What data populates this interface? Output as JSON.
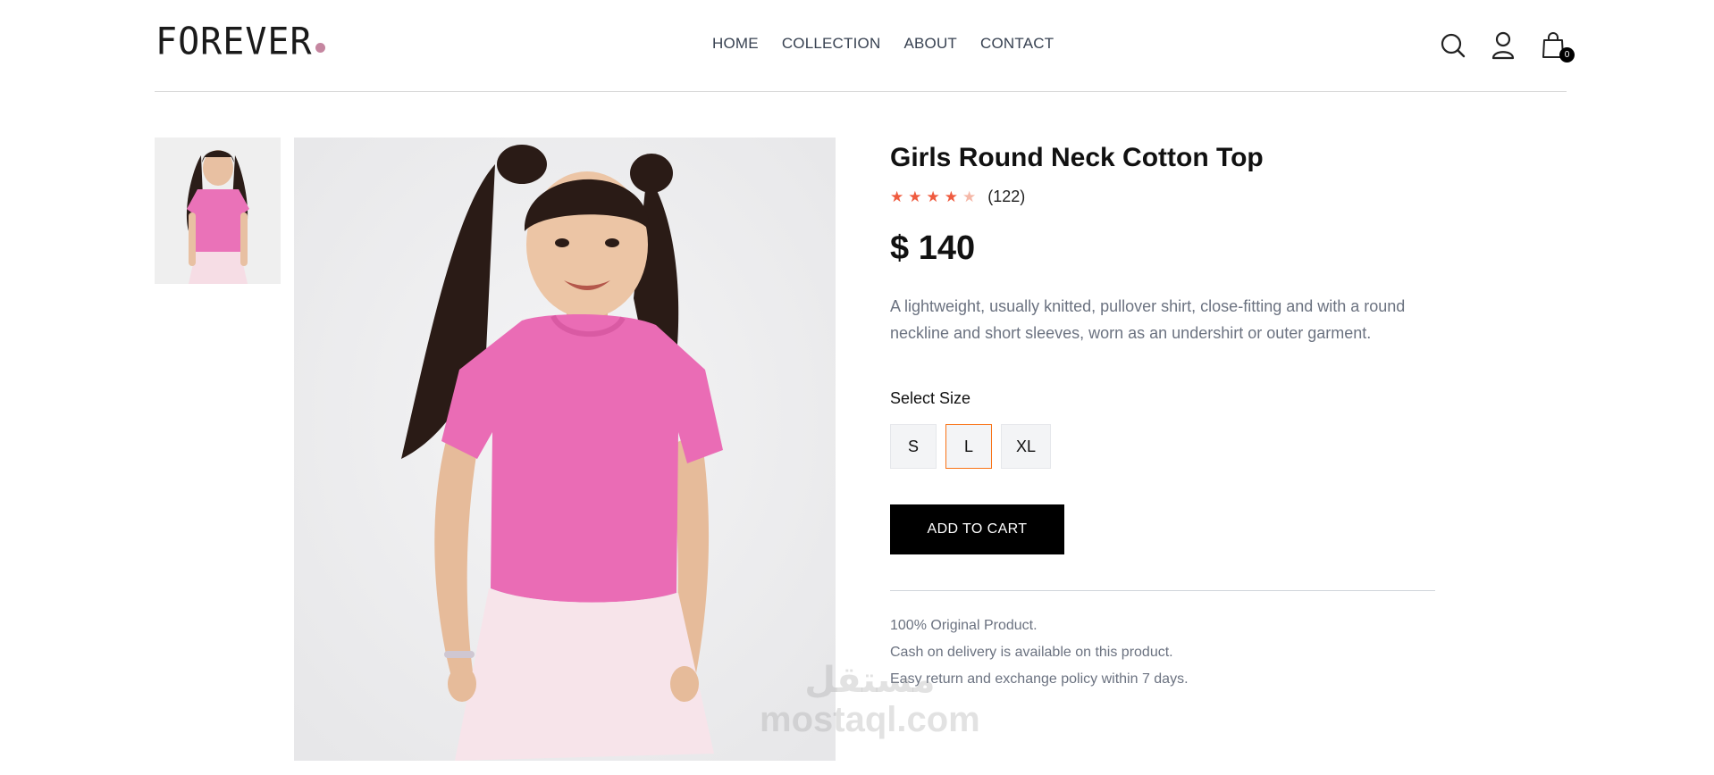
{
  "header": {
    "logo": {
      "text": "FOREVER",
      "dot_color": "#c586a0"
    },
    "nav": [
      "HOME",
      "COLLECTION",
      "ABOUT",
      "CONTACT"
    ],
    "icons": {
      "search": "search-icon",
      "profile": "user-icon",
      "cart": "shopping-bag-icon"
    },
    "cart_count": "0"
  },
  "gallery": {
    "thumbnails": [
      "product-photo-girl-pink-top"
    ],
    "main_image": "product-photo-girl-pink-top"
  },
  "product": {
    "title": "Girls Round Neck Cotton Top",
    "rating": {
      "filled_stars": 4,
      "total_stars": 5,
      "count": "(122)"
    },
    "price": "$ 140",
    "description": "A lightweight, usually knitted, pullover shirt, close-fitting and with a round neckline and short sleeves, worn as an undershirt or outer garment.",
    "size_label": "Select Size",
    "sizes": [
      {
        "label": "S",
        "selected": false
      },
      {
        "label": "L",
        "selected": true
      },
      {
        "label": "XL",
        "selected": false
      }
    ],
    "add_to_cart_label": "ADD TO CART",
    "policies": [
      "100% Original Product.",
      "Cash on delivery is available on this product.",
      "Easy return and exchange policy within 7 days."
    ]
  },
  "watermark": {
    "arabic": "مستقل",
    "latin": "mostaql.com"
  },
  "colors": {
    "accent_star": "#ef5b3f",
    "star_empty": "#f5b8a8",
    "selected_border": "#f97316",
    "button_bg": "#000000"
  }
}
